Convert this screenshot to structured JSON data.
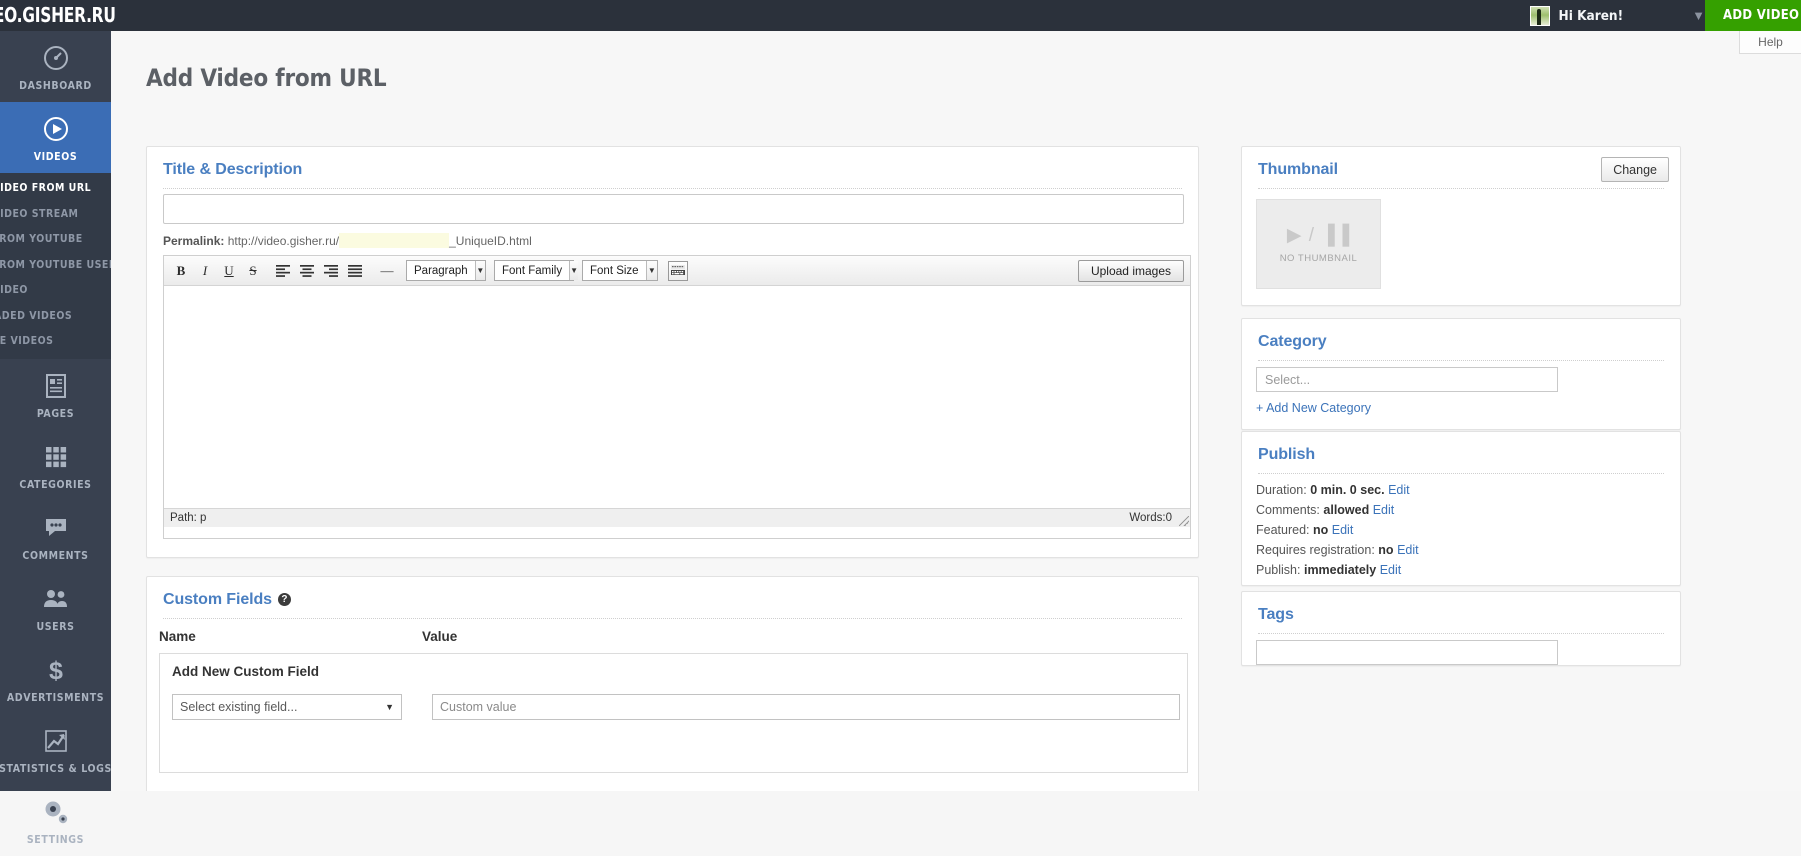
{
  "topbar": {
    "brand": "VIDEO.GISHER.RU",
    "greeting": "Hi Karen!",
    "caret_icon": "chevron-down-icon",
    "add_video_label": "ADD VIDEO",
    "avatar_icon": "avatar"
  },
  "help_tab": {
    "label": "Help"
  },
  "sidebar": {
    "items": [
      {
        "label": "DASHBOARD",
        "icon": "gauge-icon",
        "active": false
      },
      {
        "label": "VIDEOS",
        "icon": "play-circle-icon",
        "active": true
      },
      {
        "label": "PAGES",
        "icon": "document-icon",
        "active": false
      },
      {
        "label": "CATEGORIES",
        "icon": "grid-icon",
        "active": false
      },
      {
        "label": "COMMENTS",
        "icon": "speech-bubble-icon",
        "active": false
      },
      {
        "label": "USERS",
        "icon": "users-icon",
        "active": false
      },
      {
        "label": "ADVERTISMENTS",
        "icon": "dollar-icon",
        "active": false
      },
      {
        "label": "STATISTICS & LOGS",
        "icon": "chart-icon",
        "active": false
      },
      {
        "label": "SETTINGS",
        "icon": "gear-icon",
        "active": false
      }
    ],
    "submenu": [
      {
        "label": "ADD VIDEO FROM URL",
        "selected": true
      },
      {
        "label": "ADD VIDEO STREAM",
        "selected": false
      },
      {
        "label": "ADD FROM YOUTUBE",
        "selected": false
      },
      {
        "label": "ADD FROM YOUTUBE USER",
        "selected": false
      },
      {
        "label": "ADD VIDEO",
        "selected": false
      },
      {
        "label": "UPLOADED VIDEOS",
        "selected": false
      },
      {
        "label": "DELETE VIDEOS",
        "selected": false
      }
    ]
  },
  "main": {
    "page_title": "Add Video from URL",
    "title_desc": {
      "panel_title": "Title & Description",
      "title_value": "",
      "title_placeholder": "",
      "permalink_label": "Permalink:",
      "permalink_base": "http://video.gisher.ru/",
      "permalink_slug": "",
      "permalink_suffix": "_UniqueID.html"
    },
    "editor": {
      "buttons": [
        {
          "name": "bold-icon",
          "glyph": "B"
        },
        {
          "name": "italic-icon",
          "glyph": "I"
        },
        {
          "name": "underline-icon",
          "glyph": "U"
        },
        {
          "name": "strikethrough-icon",
          "glyph": "S"
        },
        {
          "name": "align-left-icon",
          "glyph": "≡"
        },
        {
          "name": "align-center-icon",
          "glyph": "≡"
        },
        {
          "name": "align-right-icon",
          "glyph": "≡"
        },
        {
          "name": "align-justify-icon",
          "glyph": "≡"
        },
        {
          "name": "horizontal-rule-icon",
          "glyph": "—"
        }
      ],
      "paragraph_select": "Paragraph",
      "font_family_select": "Font Family",
      "font_size_select": "Font Size",
      "grid_button_icon": "keyboard-icon",
      "upload_images_label": "Upload images",
      "content": "",
      "path_label": "Path: p",
      "words_label": "Words:0"
    },
    "custom_fields": {
      "panel_title": "Custom Fields",
      "help_icon": "question-mark-icon",
      "col_name": "Name",
      "col_value": "Value",
      "add_new_title": "Add New Custom Field",
      "select_placeholder": "Select existing field...",
      "value_placeholder": "Custom value"
    }
  },
  "right": {
    "thumbnail": {
      "panel_title": "Thumbnail",
      "change_label": "Change",
      "placeholder_glyph": "▶ / ▐▐",
      "placeholder_text": "NO THUMBNAIL"
    },
    "category": {
      "panel_title": "Category",
      "select_placeholder": "Select...",
      "add_new_label": "+ Add New Category"
    },
    "publish": {
      "panel_title": "Publish",
      "rows": [
        {
          "label": "Duration:",
          "value": "0 min. 0 sec.",
          "action": "Edit"
        },
        {
          "label": "Comments:",
          "value": "allowed",
          "action": "Edit"
        },
        {
          "label": "Featured:",
          "value": "no",
          "action": "Edit"
        },
        {
          "label": "Requires registration:",
          "value": "no",
          "action": "Edit"
        },
        {
          "label": "Publish:",
          "value": "immediately",
          "action": "Edit"
        }
      ]
    },
    "tags": {
      "panel_title": "Tags",
      "value": ""
    }
  },
  "colors": {
    "topbar": "#2b313b",
    "sidebar": "#394150",
    "sidebar_active": "#3b6db5",
    "accent_green": "#35a000",
    "panel_title_blue": "#4a7fc1",
    "link_blue": "#3b73b9"
  }
}
